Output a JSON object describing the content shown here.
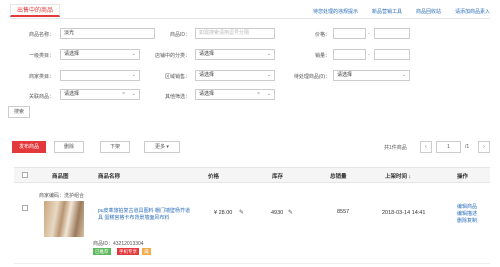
{
  "tab": {
    "label": "出售中的商品"
  },
  "top_links": [
    "待您处理的违规提示",
    "新品营销工具",
    "商品回收站",
    "请添加商品素入"
  ],
  "filters": {
    "product_name_label": "商品名称：",
    "product_name_value": "淡光",
    "product_id_label": "商品ID：",
    "product_id_placeholder": "如需搜索请用逗号分隔",
    "price_label": "价格：",
    "category_label": "一级类目：",
    "category_value": "请选择",
    "shop_category_label": "店铺中的分类：",
    "shop_category_value": "请选择",
    "sales_label": "销量：",
    "biz_label": "商家类目：",
    "biz_value": "",
    "region_label": "区域销售：",
    "region_value": "请选择",
    "pending_label": "待处理商品(0)：",
    "pending_value": "请选择",
    "related_label": "关联商品：",
    "related_value": "请选择",
    "other_label": "其他筛选：",
    "other_value": "请选择",
    "search_button": "搜索"
  },
  "actions": {
    "publish": "发布商品",
    "delete": "删除",
    "delist": "下架",
    "more": "更多 ▾",
    "pagination_total": "共1件商品",
    "page_prev": "‹",
    "page_current": "1",
    "page_total": "/1",
    "page_next": "›"
  },
  "table": {
    "headers": [
      "商品图",
      "商品名称",
      "价格",
      "库存",
      "总销量",
      "上架时间 ↓",
      "操作"
    ],
    "row": {
      "merchant_code": "商家编码：洗护组合",
      "title": "pu皮革旅拍复古道具图料 棚门墙壁杨芥道具 蛋糕宫格卡布背景墙面风布料",
      "price": "¥ 28.00",
      "stock": "4930",
      "sales": "8557",
      "listed_time": "2018-03-14 14:41",
      "product_id": "商品ID：43212013304",
      "tag1": "已推荐",
      "tag2": "手机专享",
      "tag3": "满",
      "ops": [
        "编辑商品",
        "编辑描述",
        "删除复制"
      ]
    }
  },
  "colors": {
    "accent": "#e4393c",
    "link": "#2a6ebb"
  }
}
